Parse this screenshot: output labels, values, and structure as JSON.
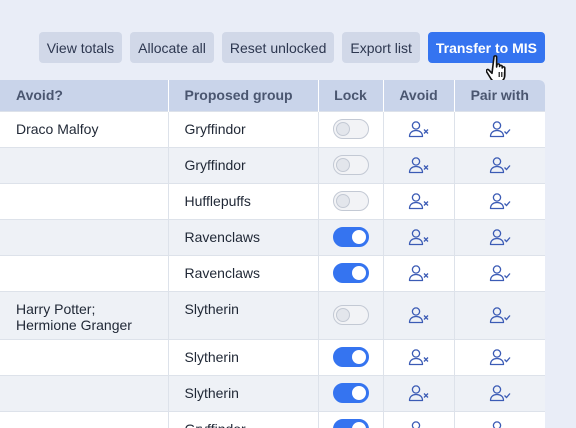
{
  "toolbar": {
    "view_totals": "View totals",
    "allocate_all": "Allocate all",
    "reset_unlocked": "Reset unlocked",
    "export_list": "Export list",
    "transfer": "Transfer to MIS"
  },
  "columns": {
    "avoid_q": "Avoid?",
    "proposed_group": "Proposed group",
    "lock": "Lock",
    "avoid": "Avoid",
    "pair_with": "Pair with"
  },
  "rows": [
    {
      "avoid": "Draco Malfoy",
      "group": "Gryffindor",
      "locked": false
    },
    {
      "avoid": "",
      "group": "Gryffindor",
      "locked": false
    },
    {
      "avoid": "",
      "group": "Hufflepuffs",
      "locked": false
    },
    {
      "avoid": "",
      "group": "Ravenclaws",
      "locked": true
    },
    {
      "avoid": "",
      "group": "Ravenclaws",
      "locked": true
    },
    {
      "avoid": "Harry Potter;\nHermione Granger",
      "group": "Slytherin",
      "locked": false
    },
    {
      "avoid": "",
      "group": "Slytherin",
      "locked": true
    },
    {
      "avoid": "",
      "group": "Slytherin",
      "locked": true
    },
    {
      "avoid": "",
      "group": "Gryffindor",
      "locked": true
    }
  ],
  "icons": {
    "avoid": "user-x-icon",
    "pair": "user-check-icon",
    "cursor": "hand-pointer-icon"
  },
  "colors": {
    "primary": "#3574f0",
    "header_bg": "#c9d4ea",
    "page_bg": "#e9edf7"
  }
}
